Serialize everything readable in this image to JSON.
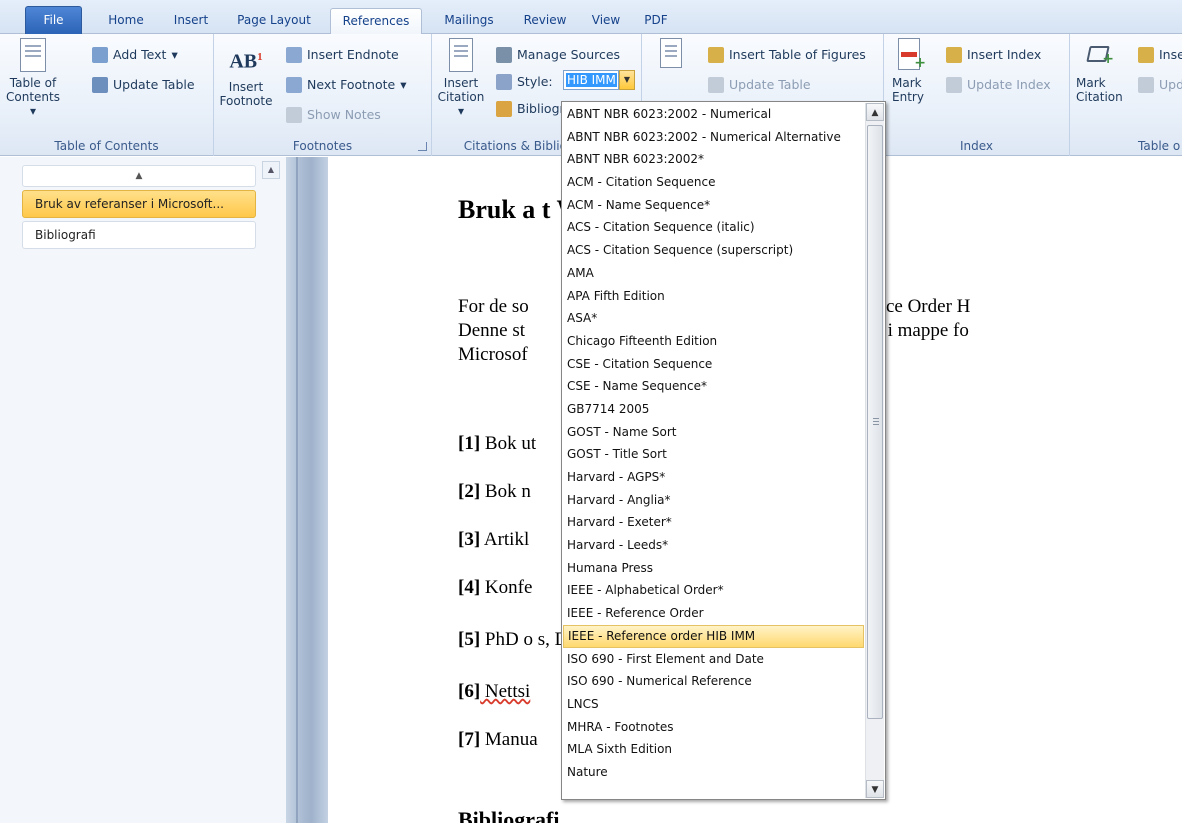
{
  "tabs": [
    "File",
    "Home",
    "Insert",
    "Page Layout",
    "References",
    "Mailings",
    "Review",
    "View",
    "PDF"
  ],
  "active_tab": "References",
  "ribbon": {
    "toc": {
      "big_label_1": "Table of",
      "big_label_2": "Contents",
      "add_text": "Add Text",
      "update_table": "Update Table",
      "group": "Table of Contents"
    },
    "footnotes": {
      "big_label_1": "Insert",
      "big_label_2": "Footnote",
      "icon_text": "AB",
      "insert_endnote": "Insert Endnote",
      "next_footnote": "Next Footnote",
      "show_notes": "Show Notes",
      "group": "Footnotes"
    },
    "citations": {
      "big_label_1": "Insert",
      "big_label_2": "Citation",
      "manage_sources": "Manage Sources",
      "style_label": "Style:",
      "style_value": "HIB IMM",
      "bibliography": "Bibliography",
      "group": "Citations & Bibliography"
    },
    "captions": {
      "insert_tof": "Insert Table of Figures",
      "update_table": "Update Table"
    },
    "index": {
      "big_label_1": "Mark",
      "big_label_2": "Entry",
      "insert_index": "Insert Index",
      "update_index": "Update Index",
      "group": "Index"
    },
    "toa": {
      "big_label_1": "Mark",
      "big_label_2": "Citation",
      "insert": "Inse",
      "update": "Upd",
      "group": "Table o"
    }
  },
  "nav": {
    "items": [
      "Bruk av referanser i Microsoft...",
      "Bibliografi"
    ],
    "selected_index": 0
  },
  "document": {
    "title": "Bruk a                               t Word",
    "para": "For de so                                          stil «IEEE – Reference Order H\nDenne st                                           EEE_HIB_IMM.xsl i mappe fo\nMicrosof                                            ography/Style.",
    "refs": [
      {
        "num": "[1]",
        "text": " Bok ut"
      },
      {
        "num": "[2]",
        "text": " Bok n"
      },
      {
        "num": "[3]",
        "text": " Artikl"
      },
      {
        "num": "[4]",
        "text": " Konfe"
      },
      {
        "num": "[5]",
        "text": " PhD o                                         s, Diverse)"
      },
      {
        "num": "[6]",
        "text": " Nettsi"
      },
      {
        "num": "[7]",
        "text": " Manua"
      }
    ],
    "heading2": "Bibliografi"
  },
  "style_dropdown": {
    "selected": "IEEE - Reference order HIB IMM",
    "options": [
      "ABNT NBR 6023:2002 - Numerical",
      "ABNT NBR 6023:2002 - Numerical Alternative",
      "ABNT NBR 6023:2002*",
      "ACM - Citation Sequence",
      "ACM - Name Sequence*",
      "ACS - Citation Sequence (italic)",
      "ACS - Citation Sequence (superscript)",
      "AMA",
      "APA Fifth Edition",
      "ASA*",
      "Chicago Fifteenth Edition",
      "CSE - Citation Sequence",
      "CSE - Name Sequence*",
      "GB7714 2005",
      "GOST - Name Sort",
      "GOST - Title Sort",
      "Harvard - AGPS*",
      "Harvard - Anglia*",
      "Harvard - Exeter*",
      "Harvard - Leeds*",
      "Humana Press",
      "IEEE - Alphabetical Order*",
      "IEEE - Reference Order",
      "IEEE - Reference order HIB IMM",
      "ISO 690 - First Element and Date",
      "ISO 690 - Numerical Reference",
      "LNCS",
      "MHRA - Footnotes",
      "MLA Sixth Edition",
      "Nature"
    ]
  },
  "colors": {
    "accent": "#2b63b6",
    "selection": "#ffd970",
    "ribbon_bg": "#eaf1fa"
  }
}
